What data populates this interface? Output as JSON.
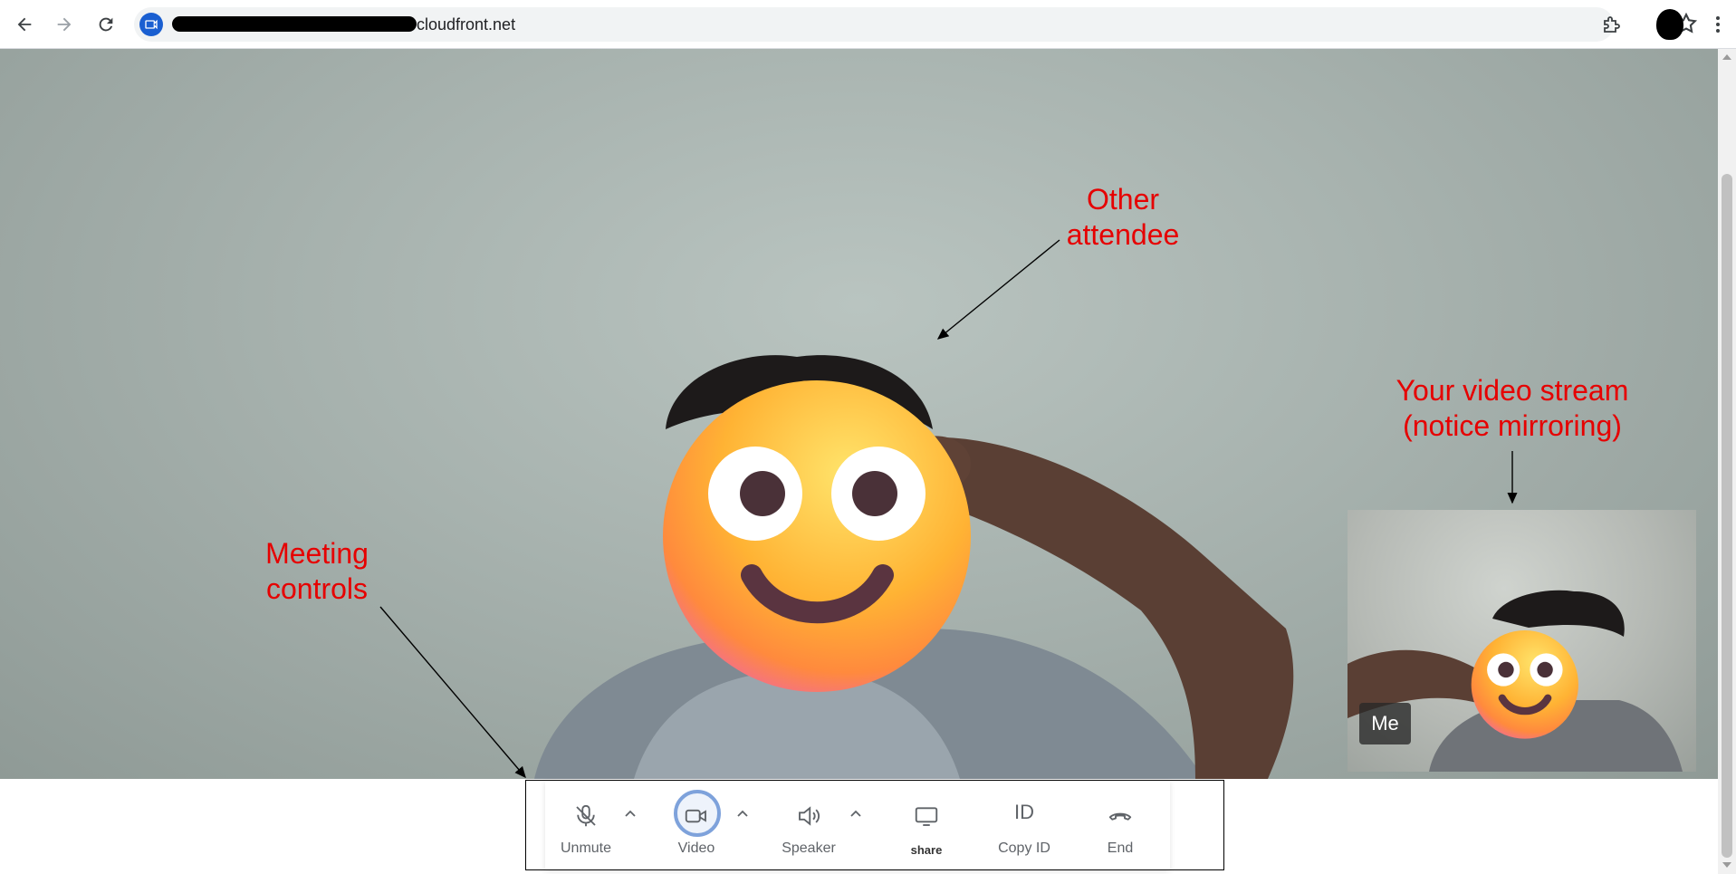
{
  "browser": {
    "url_suffix": "cloudfront.net",
    "icons": [
      "back-icon",
      "forward-icon",
      "reload-icon",
      "site-camera-icon",
      "star-icon",
      "extensions-icon",
      "profile-avatar-icon",
      "menu-kebab-icon"
    ]
  },
  "remote_video": {
    "face_emoji": "smiling-face-emoji"
  },
  "self_video": {
    "label": "Me"
  },
  "controls": {
    "mute_label": "Unmute",
    "video_label": "Video",
    "speaker_label": "Speaker",
    "share_label": "share",
    "copy_id_glyph": "ID",
    "copy_id_label": "Copy ID",
    "end_label": "End"
  },
  "annotations": {
    "other_attendee": [
      "Other",
      "attendee"
    ],
    "your_stream": [
      "Your video stream",
      "(notice mirroring)"
    ],
    "meeting_controls": [
      "Meeting",
      "controls"
    ]
  },
  "colors": {
    "annotation": "#e60000",
    "video_ring": "#7ea2db",
    "site_badge": "#1a5fd1"
  }
}
